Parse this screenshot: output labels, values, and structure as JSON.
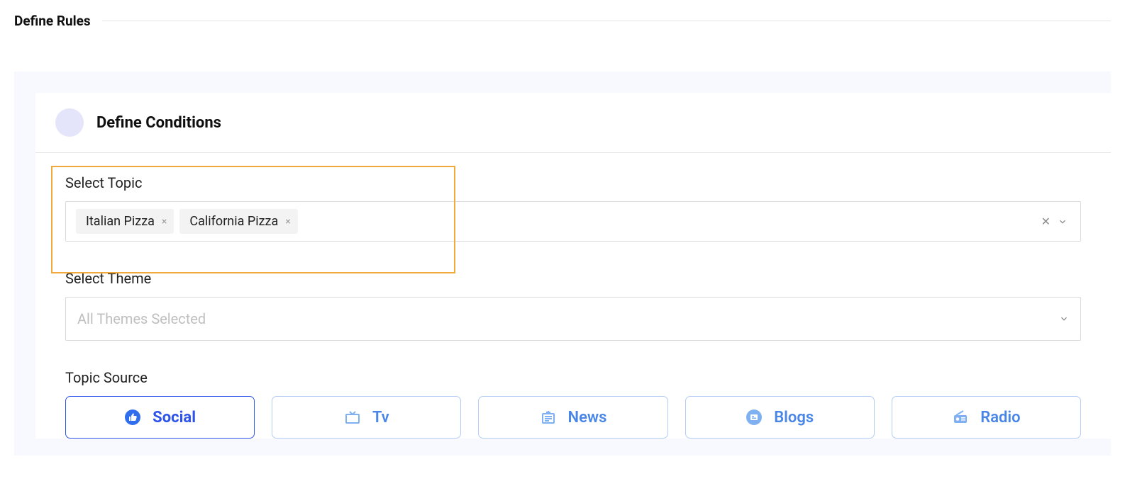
{
  "page": {
    "title": "Define Rules"
  },
  "conditions": {
    "title": "Define Conditions",
    "topic": {
      "label": "Select Topic",
      "tags": [
        "Italian Pizza",
        "California Pizza"
      ]
    },
    "theme": {
      "label": "Select Theme",
      "placeholder": "All Themes Selected"
    },
    "source": {
      "label": "Topic Source",
      "options": [
        {
          "id": "social",
          "label": "Social",
          "active": true,
          "icon": "thumb-up-icon"
        },
        {
          "id": "tv",
          "label": "Tv",
          "active": false,
          "icon": "tv-icon"
        },
        {
          "id": "news",
          "label": "News",
          "active": false,
          "icon": "news-icon"
        },
        {
          "id": "blogs",
          "label": "Blogs",
          "active": false,
          "icon": "blog-icon"
        },
        {
          "id": "radio",
          "label": "Radio",
          "active": false,
          "icon": "radio-icon"
        }
      ]
    }
  },
  "icons": {
    "remove_x": "×",
    "clear_x": "✕"
  }
}
